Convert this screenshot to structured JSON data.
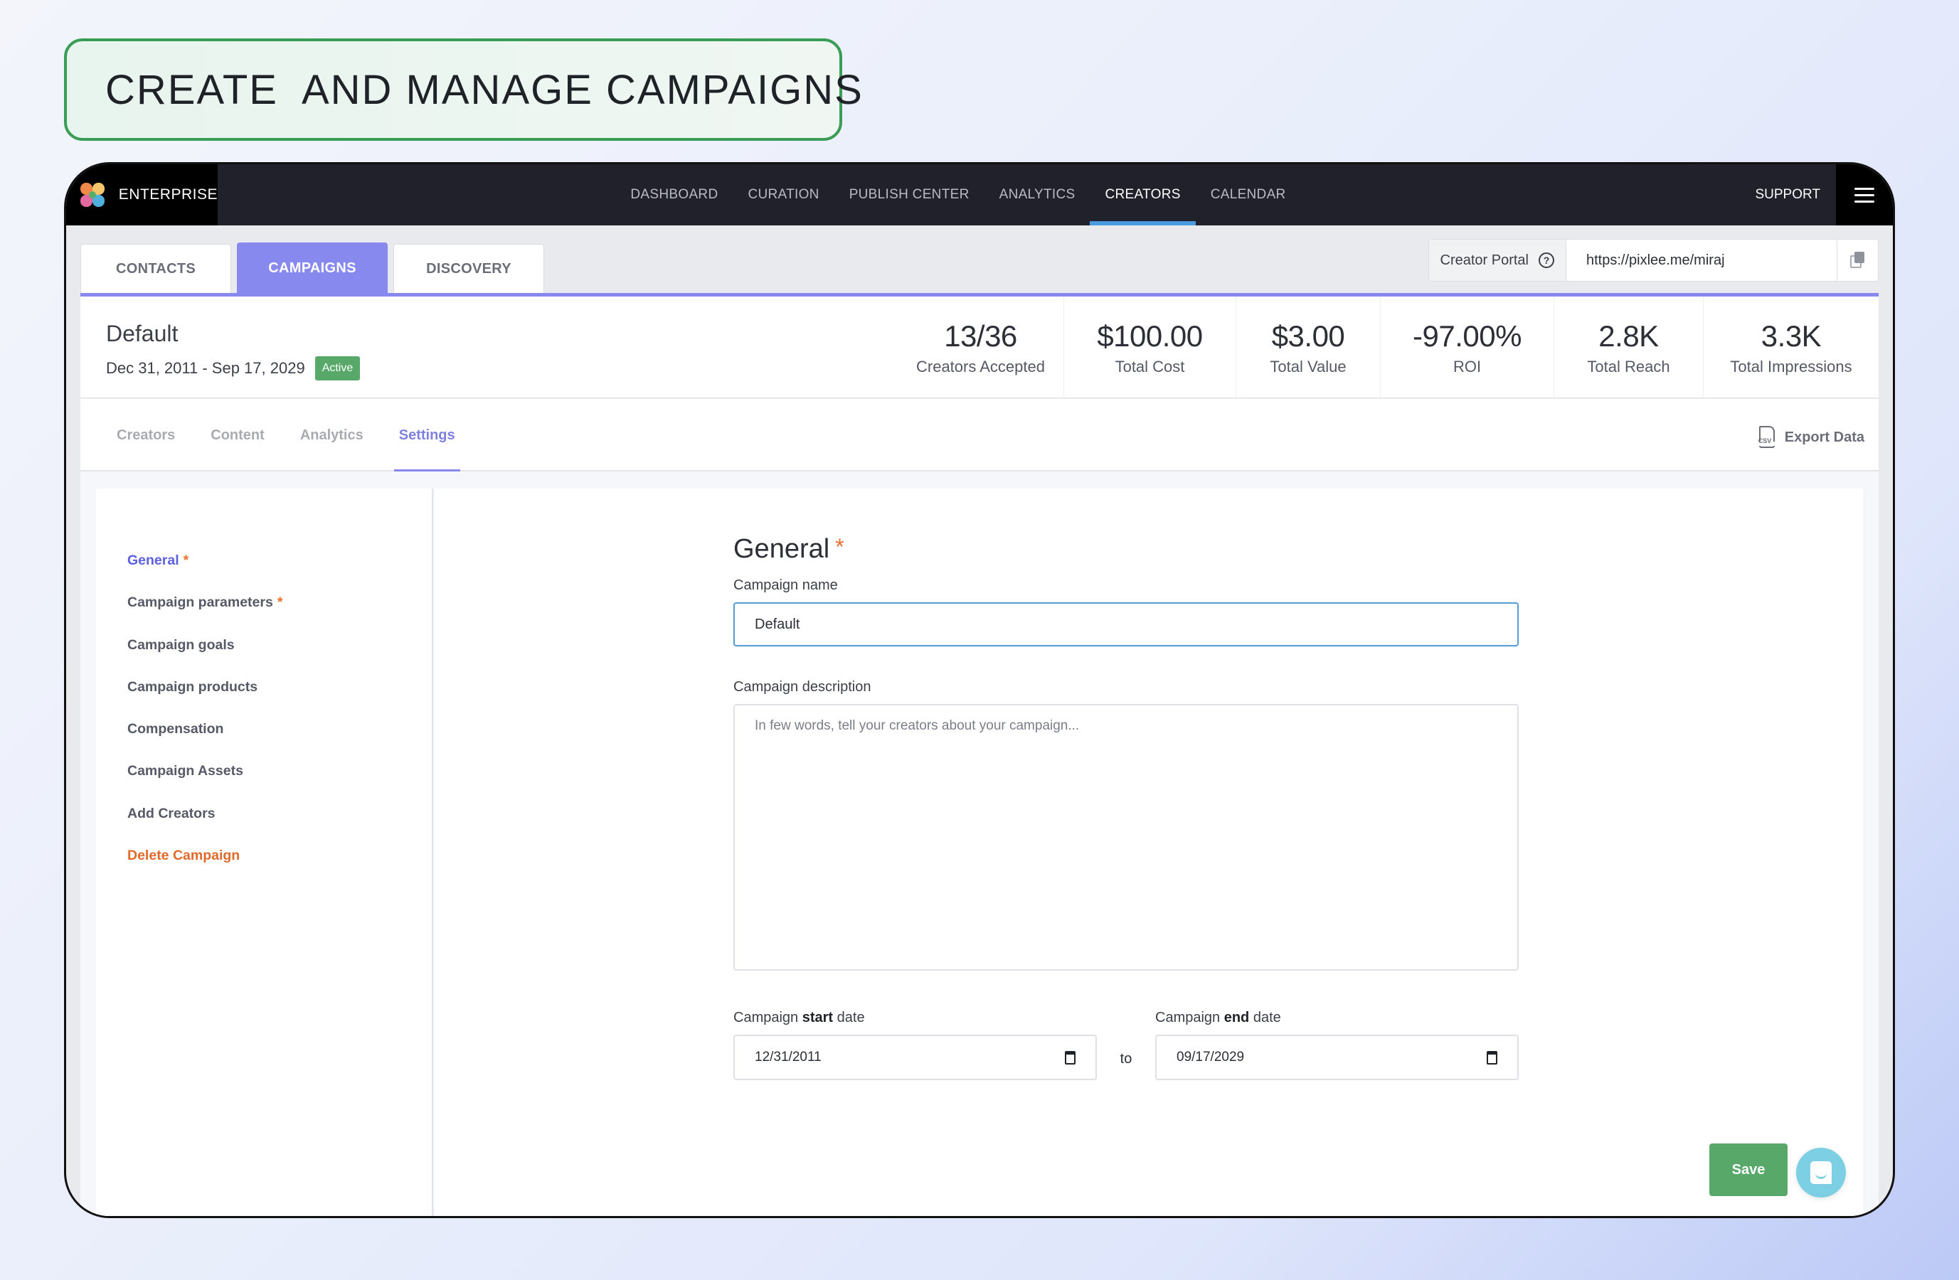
{
  "banner": {
    "title": "CREATE  AND MANAGE CAMPAIGNS"
  },
  "topnav": {
    "brand": "ENTERPRISE",
    "items": [
      {
        "label": "DASHBOARD",
        "active": false
      },
      {
        "label": "CURATION",
        "active": false
      },
      {
        "label": "PUBLISH CENTER",
        "active": false
      },
      {
        "label": "ANALYTICS",
        "active": false
      },
      {
        "label": "CREATORS",
        "active": true
      },
      {
        "label": "CALENDAR",
        "active": false
      }
    ],
    "support": "SUPPORT",
    "menu_icon": "hamburger-menu-icon"
  },
  "main_tabs": [
    {
      "label": "CONTACTS",
      "active": false
    },
    {
      "label": "CAMPAIGNS",
      "active": true
    },
    {
      "label": "DISCOVERY",
      "active": false
    }
  ],
  "creator_portal": {
    "label": "Creator Portal",
    "help_icon": "question-circle-icon",
    "url": "https://pixlee.me/miraj",
    "copy_icon": "copy-icon"
  },
  "campaign": {
    "name": "Default",
    "dates": "Dec 31, 2011 - Sep 17, 2029",
    "status": "Active"
  },
  "stats": [
    {
      "value": "13/36",
      "label": "Creators Accepted"
    },
    {
      "value": "$100.00",
      "label": "Total Cost"
    },
    {
      "value": "$3.00",
      "label": "Total Value"
    },
    {
      "value": "-97.00%",
      "label": "ROI"
    },
    {
      "value": "2.8K",
      "label": "Total Reach"
    },
    {
      "value": "3.3K",
      "label": "Total Impressions"
    }
  ],
  "sub_tabs": [
    {
      "label": "Creators",
      "active": false
    },
    {
      "label": "Content",
      "active": false
    },
    {
      "label": "Analytics",
      "active": false
    },
    {
      "label": "Settings",
      "active": true
    }
  ],
  "export": {
    "label": "Export Data",
    "icon": "csv-file-icon"
  },
  "settings_nav": [
    {
      "label": "General",
      "required": "*",
      "state": "active"
    },
    {
      "label": "Campaign parameters",
      "required": "*",
      "state": ""
    },
    {
      "label": "Campaign goals",
      "required": "",
      "state": ""
    },
    {
      "label": "Campaign products",
      "required": "",
      "state": ""
    },
    {
      "label": "Compensation",
      "required": "",
      "state": ""
    },
    {
      "label": "Campaign Assets",
      "required": "",
      "state": ""
    },
    {
      "label": "Add Creators",
      "required": "",
      "state": ""
    },
    {
      "label": "Delete Campaign",
      "required": "",
      "state": "danger"
    }
  ],
  "form": {
    "title": "General",
    "required_mark": "*",
    "name_label": "Campaign name",
    "name_value": "Default",
    "description_label": "Campaign description",
    "description_placeholder": "In few words, tell your creators about your campaign...",
    "description_value": "",
    "start_label_pre": "Campaign ",
    "start_label_bold": "start",
    "start_label_post": " date",
    "start_value": "12/31/2011",
    "to_label": "to",
    "end_label_pre": "Campaign ",
    "end_label_bold": "end",
    "end_label_post": " date",
    "end_value": "09/17/2029",
    "save_label": "Save"
  },
  "chat": {
    "icon": "chat-bubble-icon"
  },
  "colors": {
    "accent": "#8889ee",
    "nav_active_underline": "#4a9ae0",
    "success": "#58a86a",
    "danger": "#e06a2c",
    "banner_border": "#3a9d55"
  }
}
